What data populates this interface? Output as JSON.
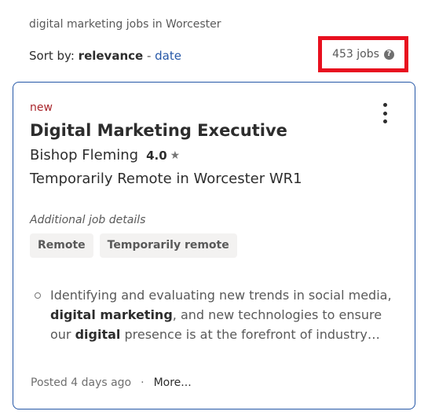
{
  "search": {
    "subtitle": "digital marketing jobs in Worcester"
  },
  "sort": {
    "label": "Sort by:",
    "active": "relevance",
    "separator": " - ",
    "alternate": "date"
  },
  "results": {
    "count": "453 jobs",
    "help_icon": "question-icon"
  },
  "job": {
    "badge": "new",
    "title": "Digital Marketing Executive",
    "company": "Bishop Fleming",
    "rating": "4.0",
    "star_icon": "star-icon",
    "location": "Temporarily Remote in Worcester WR1",
    "details_label": "Additional job details",
    "tags": [
      "Remote",
      "Temporarily remote"
    ],
    "snippet": {
      "p1": "Identifying and evaluating new trends in social media, ",
      "b1": "digital marketing",
      "p2": ", and new technologies to ensure our ",
      "b2": "digital",
      "p3": " presence is at the forefront of industry…"
    },
    "posted": "Posted 4 days ago",
    "dot": "·",
    "more": "More..."
  },
  "colors": {
    "highlight_box": "#e8101f",
    "card_border": "#2557a7",
    "new_badge": "#a9252b",
    "link": "#2557a7"
  }
}
